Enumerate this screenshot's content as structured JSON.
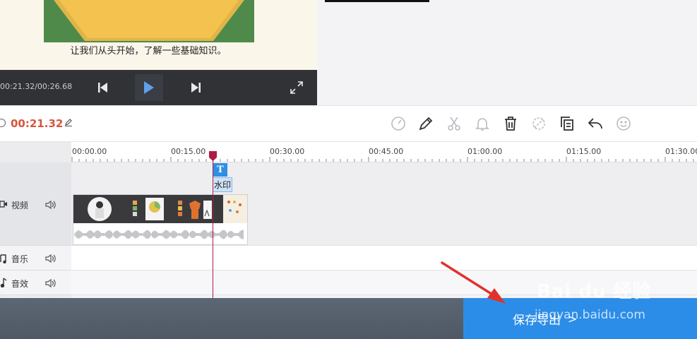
{
  "preview": {
    "subtitle": "让我们从头开始，了解一些基础知识。",
    "time_readout": "00:21.32/00:26.68"
  },
  "toolbar": {
    "current_time": "00:21.32",
    "tools": [
      "speed-icon",
      "pencil-icon",
      "scissors-icon",
      "bell-icon",
      "trash-icon",
      "unlink-icon",
      "copy-icon",
      "undo-icon",
      "smiley-icon"
    ]
  },
  "ruler": {
    "ticks": [
      "00:00.00",
      "00:15.00",
      "00:30.00",
      "00:45.00",
      "01:00.00",
      "01:15.00",
      "01:30.00"
    ]
  },
  "tracks": {
    "video_label": "视频",
    "music_label": "音乐",
    "sfx_label": "音效"
  },
  "overlay": {
    "text_marker": "T",
    "watermark_tag": "水印"
  },
  "footer": {
    "export_label": "保存导出",
    "export_chevron": ">"
  },
  "watermark": {
    "logo": "Bai du 经验",
    "site": "jingyan.baidu.com"
  },
  "colors": {
    "accent_time": "#d5553b",
    "export_blue": "#2c8de8",
    "playhead": "#b01a47",
    "annotation_arrow": "#e0322c"
  }
}
